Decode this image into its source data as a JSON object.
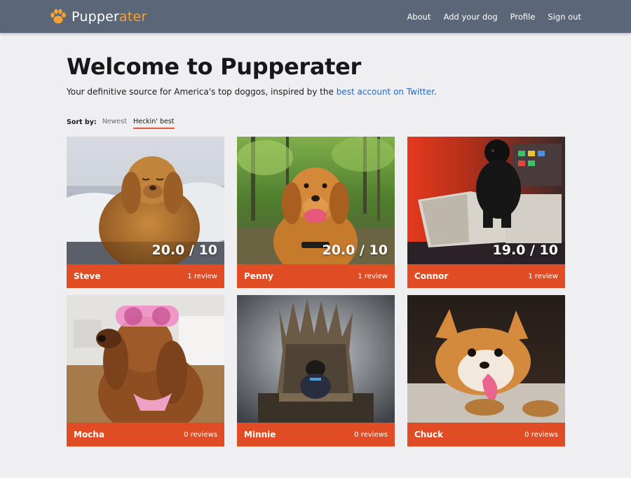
{
  "header": {
    "brand_part1": "Pupper",
    "brand_part2": "ater",
    "nav": [
      "About",
      "Add your dog",
      "Profile",
      "Sign out"
    ]
  },
  "intro": {
    "title": "Welcome to Pupperater",
    "tagline_prefix": "Your definitive source for America's top doggos, inspired by the ",
    "tagline_link": "best account on Twitter",
    "tagline_suffix": "."
  },
  "sort": {
    "label": "Sort by:",
    "options": [
      "Newest",
      "Heckin' best"
    ],
    "active": "Heckin' best"
  },
  "colors": {
    "header_bg": "#5b6778",
    "brand_accent": "#f3a234",
    "card_accent": "#e04d24",
    "link": "#2a6ab8"
  },
  "dogs": [
    {
      "name": "Steve",
      "score": "20.0 / 10",
      "reviews": "1  review"
    },
    {
      "name": "Penny",
      "score": "20.0 / 10",
      "reviews": "1  review"
    },
    {
      "name": "Connor",
      "score": "19.0 / 10",
      "reviews": "1  review"
    },
    {
      "name": "Mocha",
      "score": "",
      "reviews": "0  reviews"
    },
    {
      "name": "Minnie",
      "score": "",
      "reviews": "0  reviews"
    },
    {
      "name": "Chuck",
      "score": "",
      "reviews": "0  reviews"
    }
  ]
}
